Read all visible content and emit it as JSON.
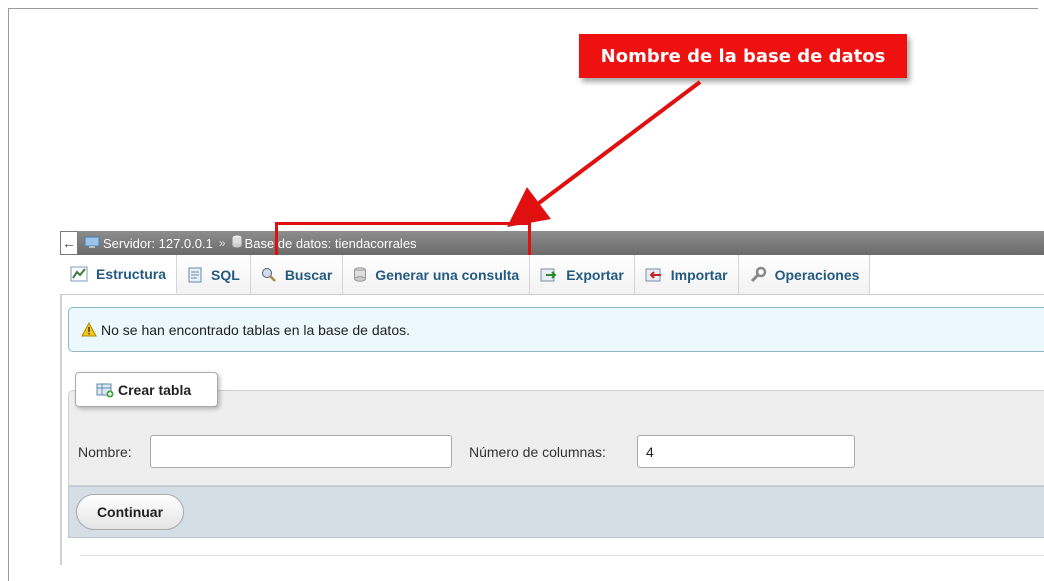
{
  "callout": {
    "text": "Nombre de la base de datos"
  },
  "breadcrumb": {
    "back_glyph": "←",
    "server": "Servidor: 127.0.0.1",
    "separator": "»",
    "database": "Base de datos: tiendacorrales"
  },
  "tabs": [
    {
      "label": "Estructura",
      "icon": "structure-icon"
    },
    {
      "label": "SQL",
      "icon": "sql-icon"
    },
    {
      "label": "Buscar",
      "icon": "search-icon"
    },
    {
      "label": "Generar una consulta",
      "icon": "query-icon"
    },
    {
      "label": "Exportar",
      "icon": "export-icon"
    },
    {
      "label": "Importar",
      "icon": "import-icon"
    },
    {
      "label": "Operaciones",
      "icon": "wrench-icon"
    }
  ],
  "notice": {
    "text": "No se han encontrado tablas en la base de datos."
  },
  "create_table": {
    "legend": "Crear tabla",
    "name_label": "Nombre:",
    "name_value": "",
    "columns_label": "Número de columnas:",
    "columns_value": "4",
    "submit": "Continuar"
  },
  "colors": {
    "callout": "#ef1010",
    "tab_text": "#235a81",
    "notice_bg": "#ebf8fd",
    "crumb_bar": "#7a7a7a"
  }
}
